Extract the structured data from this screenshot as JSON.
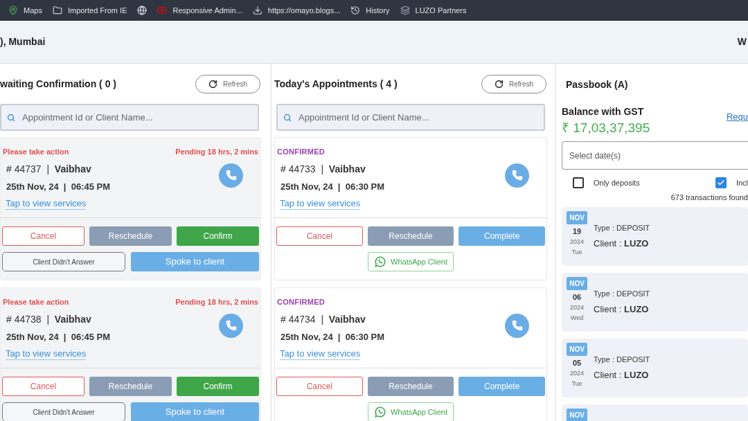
{
  "bookmarks": [
    {
      "kind": "map",
      "label": "Maps"
    },
    {
      "kind": "folder",
      "label": "Imported From IE"
    },
    {
      "kind": "globe"
    },
    {
      "kind": "video",
      "label": "Responsive Admin..."
    },
    {
      "kind": "download",
      "label": "https://omayo.blogs..."
    },
    {
      "kind": "history",
      "label": "History"
    },
    {
      "kind": "stack",
      "label": "LUZO Partners"
    }
  ],
  "header": {
    "title": "), Mumbai",
    "right_text": "W"
  },
  "columns": [
    {
      "title": "waiting Confirmation ( 0 )",
      "refresh": "Refresh",
      "search_placeholder": "Appointment Id or Client Name...",
      "cards": [
        {
          "kind": "pending",
          "status": "Please take action",
          "pending": "Pending 18 hrs, 2 mins",
          "id": "# 44737  |  **Vaibhav**",
          "datetime": "25th Nov, 24  |  06:45 PM",
          "link": "Tap to view services",
          "buttons": [
            "Cancel",
            "Reschedule",
            "Confirm"
          ],
          "extra": [
            "Client Didn't Answer",
            "Spoke to client"
          ]
        },
        {
          "kind": "pending",
          "status": "Please take action",
          "pending": "Pending 18 hrs, 2 mins",
          "id": "# 44738  |  **Vaibhav**",
          "datetime": "25th Nov, 24  |  06:45 PM",
          "link": "Tap to view services",
          "buttons": [
            "Cancel",
            "Reschedule",
            "Confirm"
          ],
          "extra": [
            "Client Didn't Answer",
            "Spoke to client"
          ]
        }
      ]
    },
    {
      "title": "Today's Appointments ( 4 )",
      "refresh": "Refresh",
      "search_placeholder": "Appointment Id or Client Name...",
      "cards": [
        {
          "kind": "confirmed",
          "status": "CONFIRMED",
          "id": "# 44733  |  **Vaibhav**",
          "datetime": "25th Nov, 24  |  06:30 PM",
          "link": "Tap to view services",
          "buttons": [
            "Cancel",
            "Reschedule",
            "Complete"
          ],
          "extra": [
            "WhatsApp Client"
          ]
        },
        {
          "kind": "confirmed",
          "status": "CONFIRMED",
          "id": "# 44734  |  **Vaibhav**",
          "datetime": "25th Nov, 24  |  06:30 PM",
          "link": "Tap to view services",
          "buttons": [
            "Cancel",
            "Reschedule",
            "Complete"
          ],
          "extra": [
            "WhatsApp Client"
          ]
        }
      ]
    }
  ],
  "passbook": {
    "title": "Passbook (A)",
    "balance_label": "Balance with GST",
    "balance": "₹ 17,03,37,395",
    "request_link": "Requ",
    "date_placeholder": "Select date(s)",
    "filters": [
      {
        "label": "Only deposits",
        "checked": false
      },
      {
        "label": "Incl",
        "checked": true
      }
    ],
    "count": "673 transactions found",
    "transactions": [
      {
        "month": "NOV",
        "day": "19",
        "year": "2024",
        "weekday": "Tue",
        "type": "Type : DEPOSIT",
        "client_label": "Client :",
        "client": "LUZO"
      },
      {
        "month": "NOV",
        "day": "06",
        "year": "2024",
        "weekday": "Wed",
        "type": "Type : DEPOSIT",
        "client_label": "Client :",
        "client": "LUZO"
      },
      {
        "month": "NOV",
        "day": "05",
        "year": "2024",
        "weekday": "Tue",
        "type": "Type : DEPOSIT",
        "client_label": "Client :",
        "client": "LUZO"
      },
      {
        "month": "NOV"
      }
    ]
  }
}
